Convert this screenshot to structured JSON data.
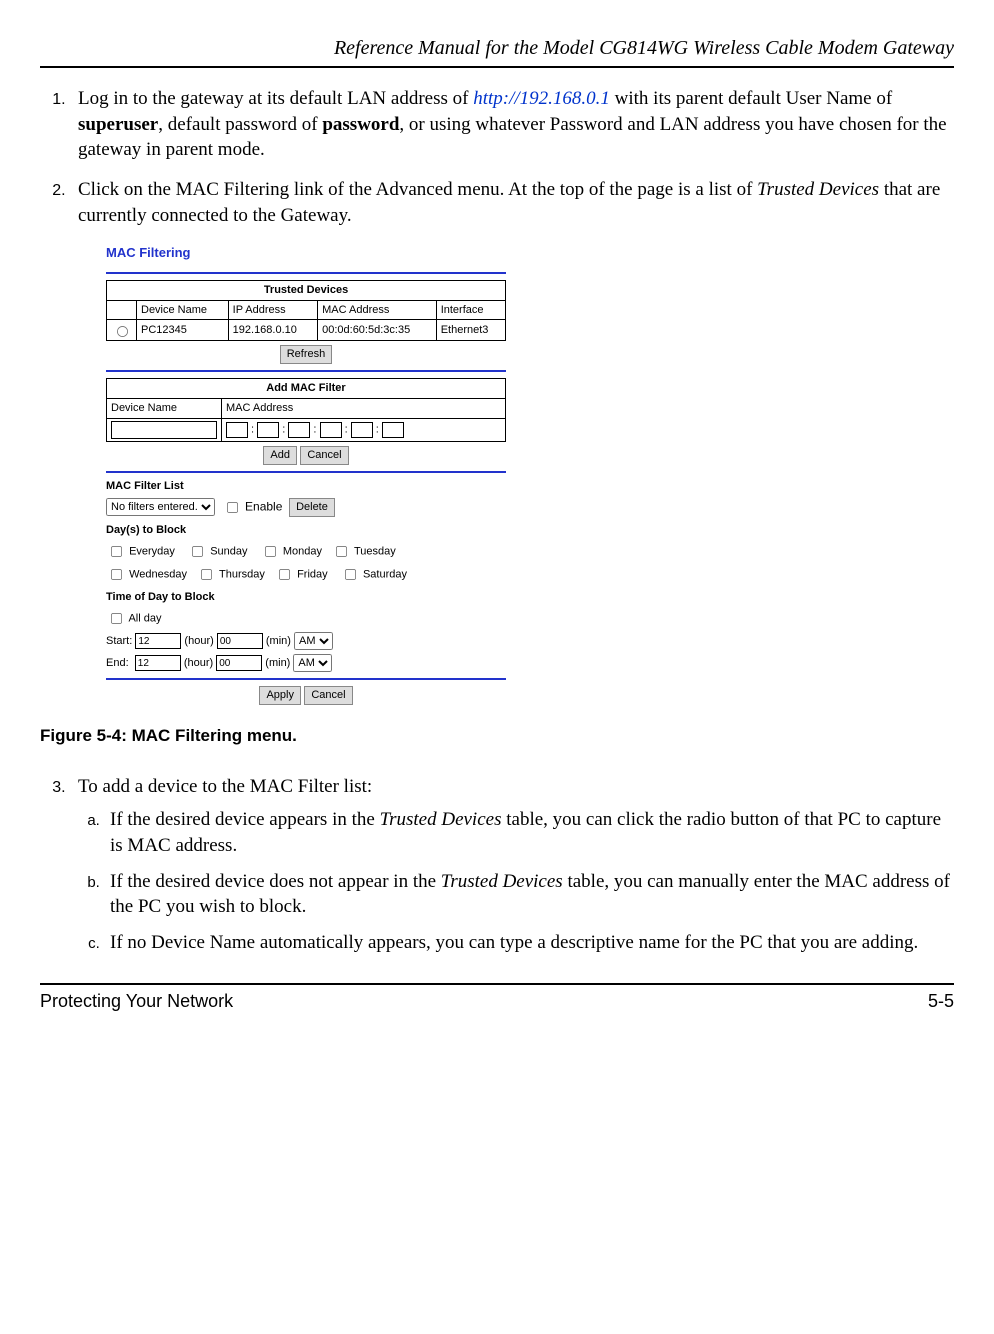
{
  "header": {
    "title": "Reference Manual for the Model CG814WG Wireless Cable Modem Gateway"
  },
  "steps": {
    "s1_a": "Log in to the gateway at its default LAN address of ",
    "s1_link": "http://192.168.0.1",
    "s1_b": " with its parent default User Name of ",
    "s1_bold1": "superuser",
    "s1_c": ", default password of ",
    "s1_bold2": "password",
    "s1_d": ", or using whatever Password and LAN address you have chosen for the gateway in parent mode.",
    "s2_a": "Click on the MAC Filtering link of the Advanced menu. At the top of the page is a list of ",
    "s2_italic": "Trusted Devices",
    "s2_b": " that are currently connected to the Gateway.",
    "s3": "To add a device to the MAC Filter list:",
    "s3a_a": "If the desired device appears in the ",
    "s3a_i": "Trusted Devices",
    "s3a_b": " table, you can click the radio button of that PC to capture is MAC address.",
    "s3b_a": "If the desired device does not appear in the ",
    "s3b_i": "Trusted Devices",
    "s3b_b": " table, you can manually enter the MAC address of the PC you wish to block.",
    "s3c": "If no Device Name automatically appears, you can type a descriptive name for the PC that you are adding."
  },
  "screenshot": {
    "title": "MAC Filtering",
    "trusted": {
      "header": "Trusted Devices",
      "cols": {
        "c1": "Device Name",
        "c2": "IP Address",
        "c3": "MAC Address",
        "c4": "Interface"
      },
      "row": {
        "name": "PC12345",
        "ip": "192.168.0.10",
        "mac": "00:0d:60:5d:3c:35",
        "iface": "Ethernet3"
      },
      "refresh": "Refresh"
    },
    "addfilter": {
      "header": "Add MAC Filter",
      "c1": "Device Name",
      "c2": "MAC Address",
      "add": "Add",
      "cancel": "Cancel"
    },
    "filterlist": {
      "title": "MAC Filter List",
      "opt": "No filters entered.",
      "enable": "Enable",
      "delete": "Delete"
    },
    "days": {
      "title": "Day(s) to Block",
      "d1": "Everyday",
      "d2": "Sunday",
      "d3": "Monday",
      "d4": "Tuesday",
      "d5": "Wednesday",
      "d6": "Thursday",
      "d7": "Friday",
      "d8": "Saturday"
    },
    "time": {
      "title": "Time of Day to Block",
      "allday": "All day",
      "start": "Start:",
      "end": "End:",
      "hour": "(hour)",
      "min": "(min)",
      "sh": "12",
      "sm": "00",
      "sap": "AM",
      "eh": "12",
      "em": "00",
      "eap": "AM"
    },
    "apply": "Apply",
    "cancel2": "Cancel"
  },
  "caption": "Figure 5-4: MAC Filtering menu.",
  "footer": {
    "left": "Protecting Your Network",
    "right": "5-5"
  }
}
